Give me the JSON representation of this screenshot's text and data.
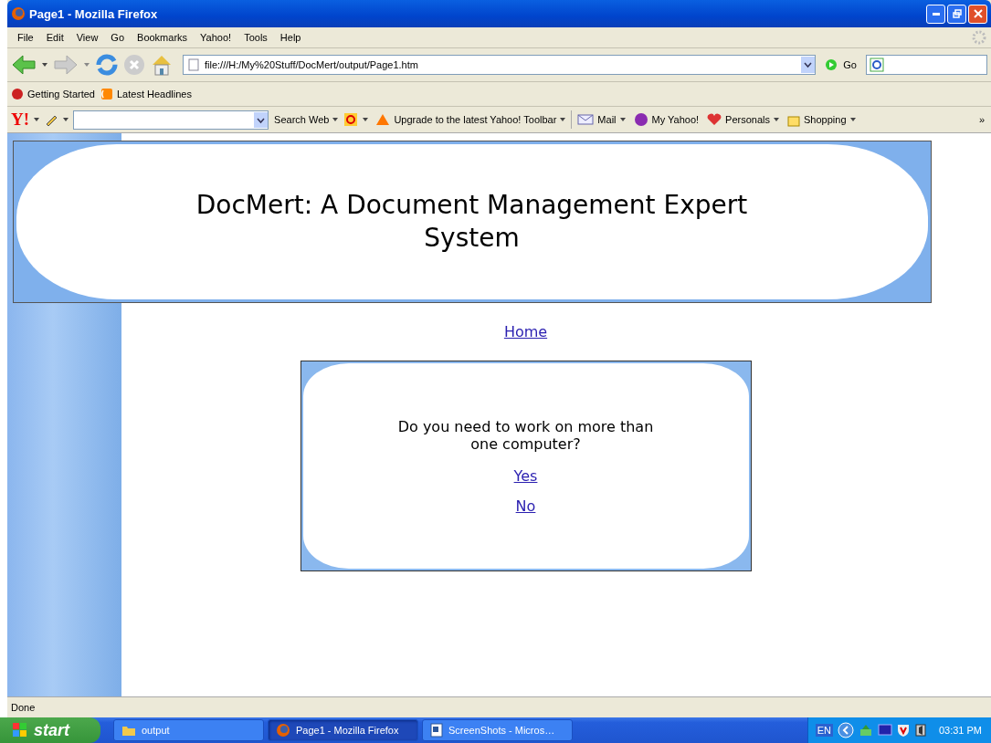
{
  "window": {
    "title": "Page1 - Mozilla Firefox"
  },
  "menu": [
    "File",
    "Edit",
    "View",
    "Go",
    "Bookmarks",
    "Yahoo!",
    "Tools",
    "Help"
  ],
  "navigation": {
    "url": "file:///H:/My%20Stuff/DocMert/output/Page1.htm",
    "go": "Go"
  },
  "bookmarks": [
    "Getting Started",
    "Latest Headlines"
  ],
  "yahoo_toolbar": {
    "logo": "Y!",
    "search": "Search Web",
    "upgrade": "Upgrade to the latest Yahoo! Toolbar",
    "mail": "Mail",
    "my_yahoo": "My Yahoo!",
    "personals": "Personals",
    "shopping": "Shopping",
    "more": "»"
  },
  "page": {
    "title": "DocMert: A Document Management Expert System",
    "home_link": "Home",
    "question": "Do you need to work on more than one computer?",
    "answers": [
      "Yes",
      "No"
    ]
  },
  "status_bar": "Done",
  "taskbar": {
    "start": "start",
    "items": [
      {
        "label": "output",
        "selected": false
      },
      {
        "label": "Page1 - Mozilla Firefox",
        "selected": true
      },
      {
        "label": "ScreenShots - Micros…",
        "selected": false
      }
    ],
    "language": "EN",
    "clock": "03:31 PM"
  }
}
